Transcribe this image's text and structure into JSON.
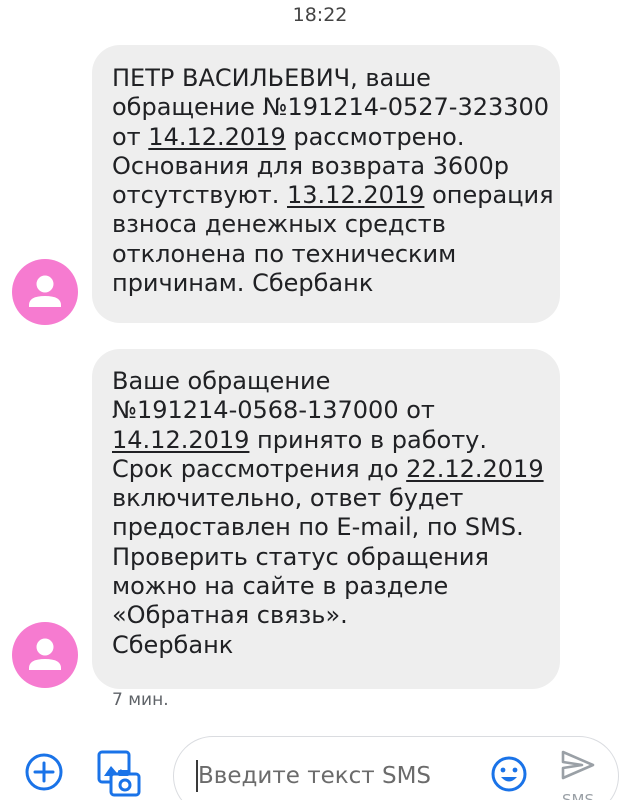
{
  "status_bar": {
    "time": "18:22"
  },
  "messages": [
    {
      "lines": [
        [
          {
            "t": "ПЕТР ВАСИЛЬЕВИЧ, ваше"
          }
        ],
        [
          {
            "t": "обращение №191214-0527-323300"
          }
        ],
        [
          {
            "t": "от "
          },
          {
            "t": "14.12.2019",
            "link": true
          },
          {
            "t": " рассмотрено."
          }
        ],
        [
          {
            "t": "Основания для возврата 3600р"
          }
        ],
        [
          {
            "t": "отсутствуют. "
          },
          {
            "t": "13.12.2019",
            "link": true
          },
          {
            "t": " операция"
          }
        ],
        [
          {
            "t": "взноса денежных средств"
          }
        ],
        [
          {
            "t": "отклонена по техническим"
          }
        ],
        [
          {
            "t": "причинам. Сбербанк"
          }
        ]
      ]
    },
    {
      "lines": [
        [
          {
            "t": "Ваше обращение"
          }
        ],
        [
          {
            "t": "№191214-0568-137000 от"
          }
        ],
        [
          {
            "t": "14.12.2019",
            "link": true
          },
          {
            "t": " принято в работу."
          }
        ],
        [
          {
            "t": "Срок рассмотрения до "
          },
          {
            "t": "22.12.2019",
            "link": true
          }
        ],
        [
          {
            "t": "включительно, ответ будет"
          }
        ],
        [
          {
            "t": "предоставлен по E-mail, по SMS."
          }
        ],
        [
          {
            "t": "Проверить статус обращения"
          }
        ],
        [
          {
            "t": "можно на сайте в разделе"
          }
        ],
        [
          {
            "t": "«Обратная связь»."
          }
        ],
        [
          {
            "t": "Сбербанк"
          }
        ]
      ],
      "time": "7 мин."
    }
  ],
  "compose": {
    "placeholder": "Введите текст SMS",
    "value": "",
    "send_label": "SMS"
  },
  "icons": {
    "add": "add-circle-icon",
    "gallery": "gallery-icon",
    "emoji": "emoji-icon",
    "send": "send-icon",
    "avatar": "person-icon"
  },
  "colors": {
    "accent": "#1a73e8",
    "avatar": "#f67bd0",
    "bubble": "#eeeeee",
    "text": "#202124",
    "muted": "#5f6368"
  }
}
